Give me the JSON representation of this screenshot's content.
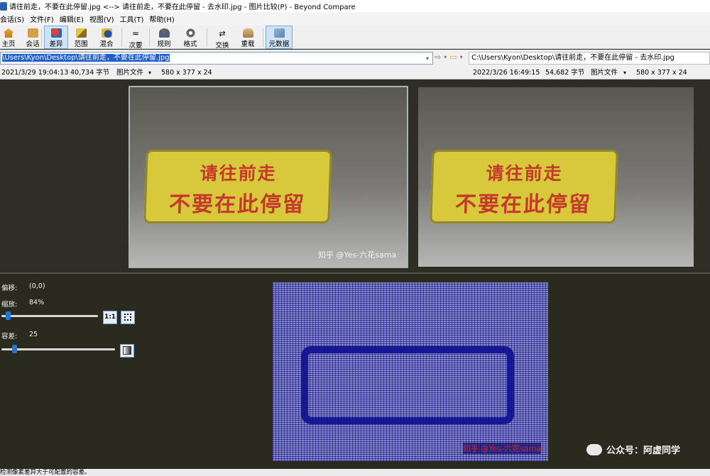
{
  "window": {
    "title": "请往前走，不要在此停留.jpg <--> 请往前走，不要在此停留 - 去水印.jpg - 图片比较(P) - Beyond Compare"
  },
  "menu": [
    "会话(S)",
    "文件(F)",
    "编辑(E)",
    "视图(V)",
    "工具(T)",
    "帮助(H)"
  ],
  "toolbar": {
    "home": "主页",
    "session": "会话",
    "diff": "差异",
    "range": "范围",
    "blend": "混合",
    "minor": "次要",
    "rules": "规则",
    "format": "格式",
    "swap": "交换",
    "reload": "重载",
    "metadata": "元数据"
  },
  "left_file": {
    "path": "C:\\Users\\Kyon\\Desktop\\请往前走，不要在此停留.jpg",
    "path_visible": "\\Users\\Kyon\\Desktop\\请往前走，不要在此停留.jpg",
    "date": "2021/3/29 19:04:13",
    "size": "40,734 字节",
    "type": "图片文件",
    "dims": "580 x 377 x 24"
  },
  "right_file": {
    "path": "C:\\Users\\Kyon\\Desktop\\请往前走，不要在此停留 - 去水印.jpg",
    "date": "2022/3/26 16:49:15",
    "size": "54,682 字节",
    "type": "图片文件",
    "dims": "580 x 377 x 24"
  },
  "image": {
    "line1": "请往前走",
    "line2": "不要在此停留",
    "watermark": "知乎 @Yes-六花sama",
    "mat_color": "#d8c93c",
    "text_color": "#c4392a"
  },
  "controls": {
    "offset_label": "偏移:",
    "offset_value": "(0,0)",
    "zoom_label": "缩放:",
    "zoom_value": "84%",
    "zoom_1to1": "1:1",
    "tolerance_label": "容差:",
    "tolerance_value": "25",
    "zoom_level": 0.05,
    "tolerance_level": 0.1
  },
  "diff": {
    "watermark": "知乎 @Yes-六花sama",
    "diff_color": "#0b0b8f"
  },
  "brand": {
    "text": "公众号：阿虚同学"
  },
  "status": {
    "text": "检测像素差异大于可配置的容差。"
  }
}
